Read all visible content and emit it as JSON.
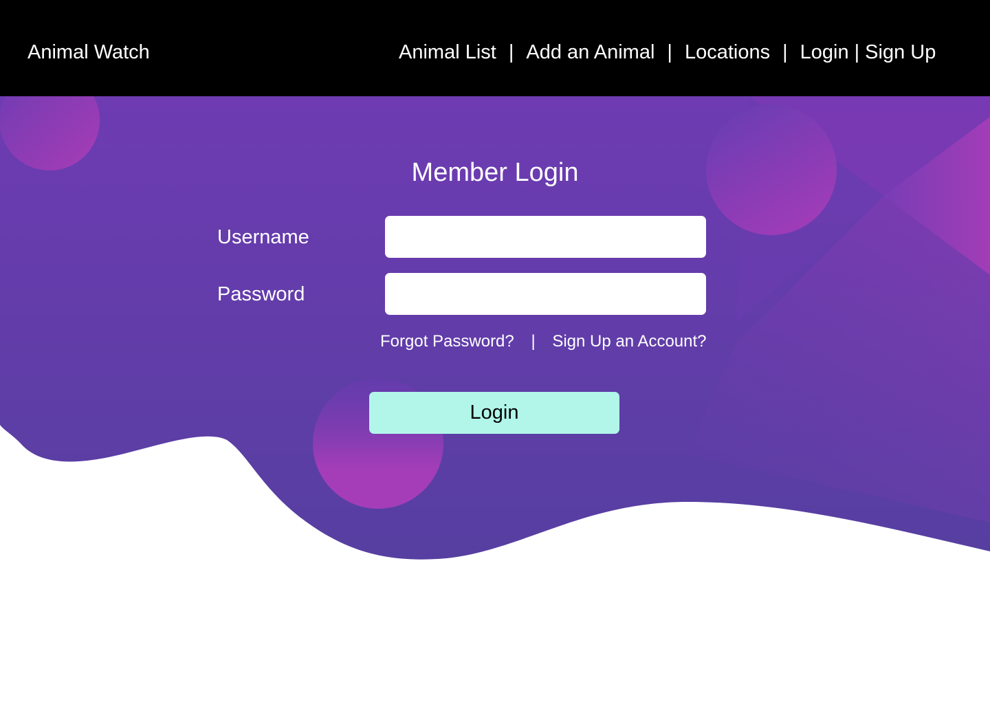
{
  "header": {
    "brand": "Animal Watch",
    "nav": {
      "animal_list": "Animal List",
      "add_animal": "Add an Animal",
      "locations": "Locations",
      "login": "Login",
      "sign_up": "Sign Up",
      "separator": "|"
    }
  },
  "form": {
    "title": "Member Login",
    "username_label": "Username",
    "username_value": "",
    "password_label": "Password",
    "password_value": "",
    "forgot_password": "Forgot Password?",
    "link_separator": "|",
    "sign_up_account": "Sign Up an Account?",
    "login_button": "Login"
  },
  "colors": {
    "header_bg": "#000000",
    "hero_gradient_top": "#6d3bb2",
    "hero_gradient_bottom": "#5a3fa0",
    "accent_magenta": "#a63db8",
    "login_button_bg": "#b2f6ea",
    "input_bg": "#ffffff"
  }
}
